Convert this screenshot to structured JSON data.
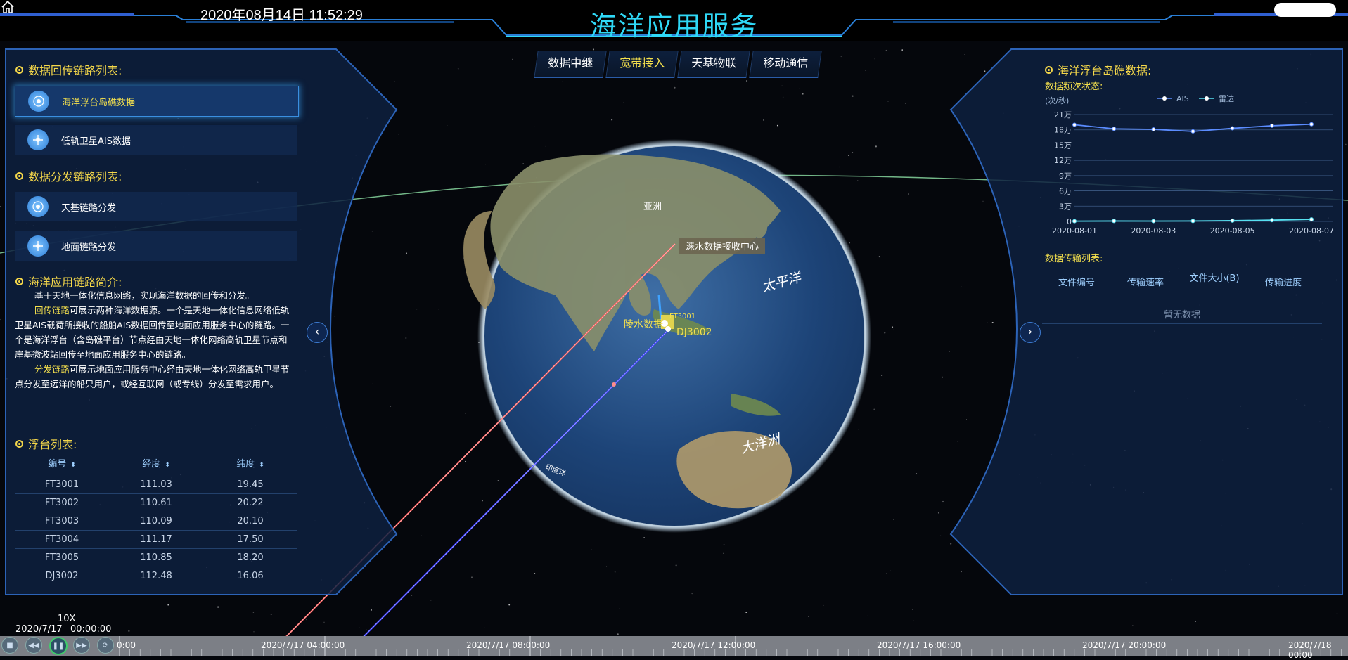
{
  "header": {
    "datetime": "2020年08月14日 11:52:29",
    "title": "海洋应用服务"
  },
  "tabs": [
    {
      "label": "数据中继",
      "active": false
    },
    {
      "label": "宽带接入",
      "active": true
    },
    {
      "label": "天基物联",
      "active": false
    },
    {
      "label": "移动通信",
      "active": false
    }
  ],
  "left_panel": {
    "return_links_title": "数据回传链路列表:",
    "return_links": [
      {
        "label": "海洋浮台岛礁数据",
        "selected": true
      },
      {
        "label": "低轨卫星AIS数据",
        "selected": false
      }
    ],
    "dist_links_title": "数据分发链路列表:",
    "dist_links": [
      {
        "label": "天基链路分发"
      },
      {
        "label": "地面链路分发"
      }
    ],
    "intro_title": "海洋应用链路简介:",
    "intro_p1": "基于天地一体化信息网络，实现海洋数据的回传和分发。",
    "intro_hl1": "回传链路",
    "intro_p2": "可展示两种海洋数据源。一个是天地一体化信息网络低轨卫星AIS载荷所接收的船舶AIS数据回传至地面应用服务中心的链路。一个是海洋浮台（含岛礁平台）节点经由天地一体化网络高轨卫星节点和岸基微波站回传至地面应用服务中心的链路。",
    "intro_hl2": "分发链路",
    "intro_p3": "可展示地面应用服务中心经由天地一体化网络高轨卫星节点分发至远洋的船只用户，或经互联网（或专线）分发至需求用户。",
    "platforms_title": "浮台列表:",
    "table_headers": [
      "编号",
      "经度",
      "纬度"
    ],
    "table_rows": [
      [
        "FT3001",
        "111.03",
        "19.45"
      ],
      [
        "FT3002",
        "110.61",
        "20.22"
      ],
      [
        "FT3003",
        "110.09",
        "20.10"
      ],
      [
        "FT3004",
        "111.17",
        "17.50"
      ],
      [
        "FT3005",
        "110.85",
        "18.20"
      ],
      [
        "DJ3002",
        "112.48",
        "16.06"
      ]
    ]
  },
  "globe": {
    "label_asia": "亚洲",
    "label_pacific": "太平洋",
    "label_indian": "大洋洲",
    "label_small": "印度洋",
    "receive_center": "涞水数据接收中心",
    "label_lingshui": "陵水数据",
    "label_dj": "DJ3002",
    "label_cluster": "FT3001"
  },
  "right_panel": {
    "title": "海洋浮台岛礁数据:",
    "freq_title": "数据频次状态:",
    "transfer_title": "数据传输列表:",
    "transfer_headers": [
      "文件编号",
      "传输速率",
      "文件大小(B)",
      "传输进度"
    ],
    "transfer_empty": "暂无数据"
  },
  "chart_data": {
    "type": "line",
    "ylabel": "(次/秒)",
    "y_ticks": [
      "0",
      "3万",
      "6万",
      "9万",
      "12万",
      "15万",
      "18万",
      "21万"
    ],
    "ylim": [
      0,
      210000
    ],
    "x": [
      "2020-08-01",
      "2020-08-02",
      "2020-08-03",
      "2020-08-04",
      "2020-08-05",
      "2020-08-06",
      "2020-08-07"
    ],
    "x_tick_labels": [
      "2020-08-01",
      "2020-08-03",
      "2020-08-05",
      "2020-08-07"
    ],
    "series": [
      {
        "name": "AIS",
        "color": "#5b8cff",
        "values": [
          190000,
          182000,
          181000,
          177000,
          183000,
          188000,
          191000
        ]
      },
      {
        "name": "雷达",
        "color": "#57e0f0",
        "values": [
          500,
          800,
          700,
          900,
          1500,
          2500,
          4000
        ]
      }
    ],
    "legend_position": "top-right",
    "grid": true
  },
  "timeline": {
    "speed": "10X",
    "date": "2020/7/17",
    "time": "00:00:00",
    "labels": [
      "0:00",
      "2020/7/17 04:00:00",
      "2020/7/17 08:00:00",
      "2020/7/17 12:00:00",
      "2020/7/17 16:00:00",
      "2020/7/17 20:00:00",
      "2020/7/18 00:00"
    ]
  }
}
